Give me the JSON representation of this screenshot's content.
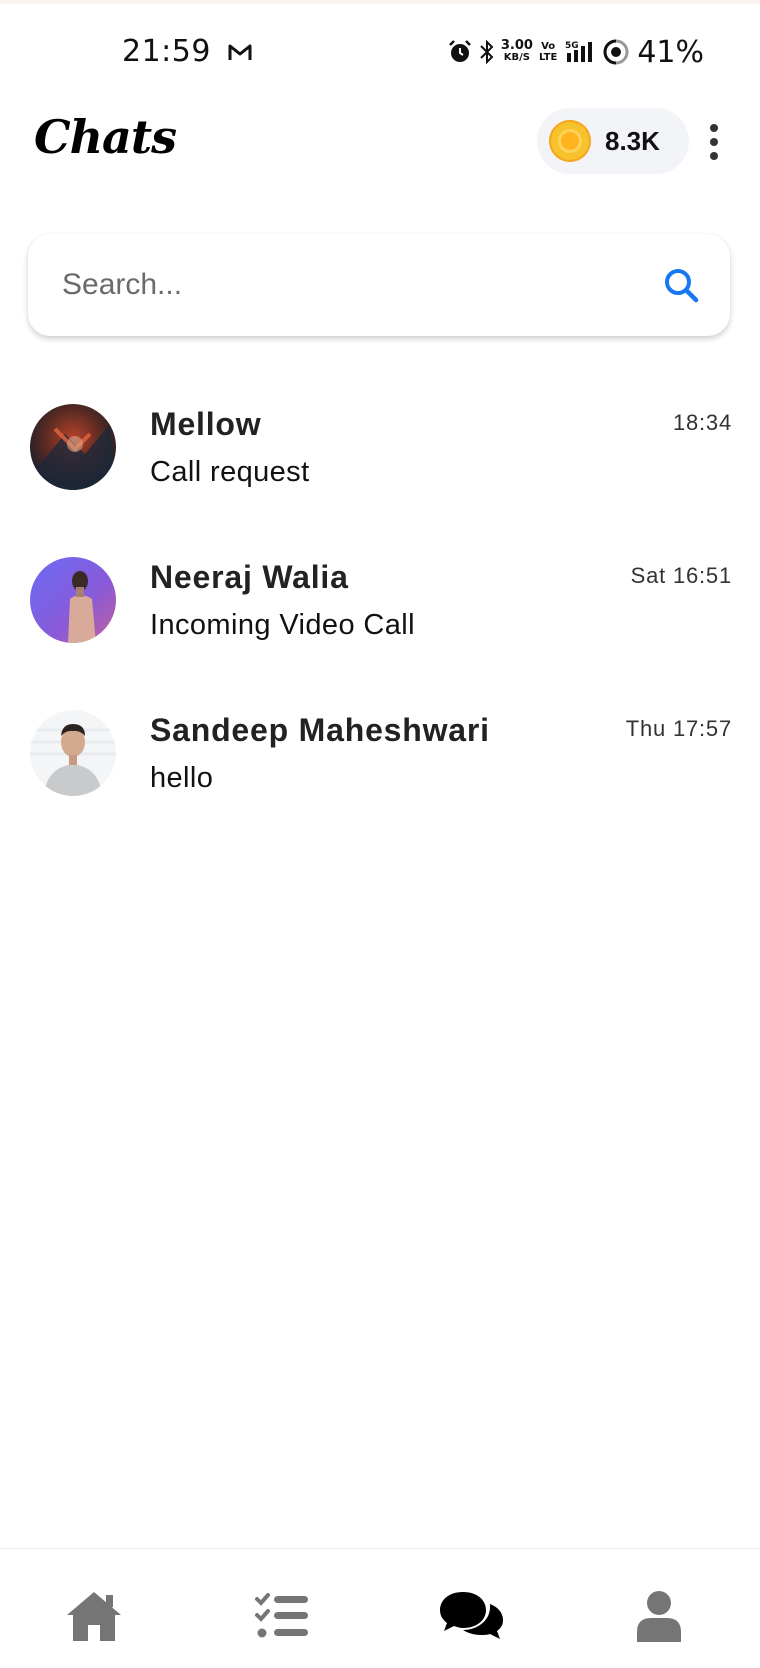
{
  "status_bar": {
    "time": "21:59",
    "net_speed_value": "3.00",
    "net_speed_unit": "KB/S",
    "volte_top": "Vo",
    "volte_bottom": "LTE",
    "network": "5G",
    "battery": "41%",
    "icons": [
      "gmail-icon",
      "alarm-icon",
      "bluetooth-icon",
      "signal-icon",
      "battery-icon"
    ]
  },
  "header": {
    "title": "Chats",
    "coins": "8.3K",
    "coin_icon": "coin-icon",
    "menu_icon": "more-vertical-icon"
  },
  "search": {
    "placeholder": "Search...",
    "value": "",
    "icon": "search-icon",
    "icon_color": "#1877f2"
  },
  "chats": [
    {
      "name": "Mellow",
      "message": "Call request",
      "time": "18:34"
    },
    {
      "name": "Neeraj Walia",
      "message": "Incoming Video Call",
      "time": "Sat 16:51"
    },
    {
      "name": "Sandeep Maheshwari",
      "message": "hello",
      "time": "Thu 17:57"
    }
  ],
  "bottom_nav": {
    "items": [
      {
        "name": "home",
        "icon": "home-icon",
        "active": false
      },
      {
        "name": "tasks",
        "icon": "checklist-icon",
        "active": false
      },
      {
        "name": "chats",
        "icon": "chat-bubbles-icon",
        "active": true
      },
      {
        "name": "profile",
        "icon": "user-icon",
        "active": false
      }
    ],
    "active_color": "#000000",
    "inactive_color": "#757575"
  }
}
